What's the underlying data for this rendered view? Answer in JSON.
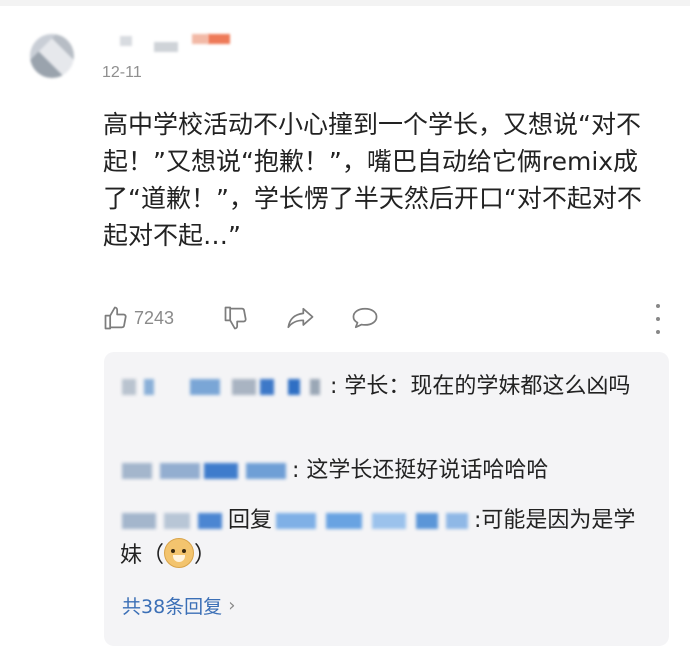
{
  "comment": {
    "timestamp": "12-11",
    "text": "高中学校活动不小心撞到一个学长，又想说“对不起！”又想说“抱歉！”，嘴巴自动给它俩remix成了“道歉！”，学长愣了半天然后开口“对不起对不起对不起…”",
    "like_count": "7243"
  },
  "icons": {
    "like": "thumbs-up-icon",
    "dislike": "thumbs-down-icon",
    "share": "share-icon",
    "reply": "speech-bubble-icon",
    "more": "more-vertical-icon",
    "reply_emoji": "doge-emoji-icon"
  },
  "replies": [
    {
      "text": ": 学长：现在的学妹都这么凶吗"
    },
    {
      "text": ": 这学长还挺好说话哈哈哈"
    },
    {
      "reply_word": "回复",
      "text_before_emoji": ":可能是因为是学妹（",
      "text_after_emoji": "）"
    }
  ],
  "replies_total": "共38条回复",
  "colors": {
    "link": "#3b6fb6",
    "reply_bg": "#f4f4f6",
    "meta_text": "#8f8f8f"
  }
}
